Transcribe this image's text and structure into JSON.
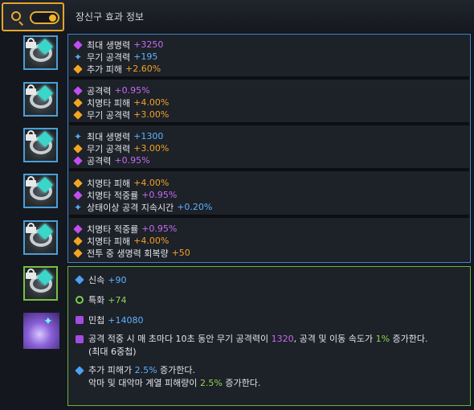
{
  "header": {
    "title": "장신구 효과 정보"
  },
  "panels": [
    {
      "rows": [
        {
          "icon": "purple",
          "label": "최대 생명력",
          "value": "+3250",
          "color": "purple"
        },
        {
          "icon": "star",
          "label": "무기 공격력",
          "value": "+195",
          "color": "blue"
        },
        {
          "icon": "orange",
          "label": "추가 피해",
          "value": "+2.60%",
          "color": "orange"
        }
      ]
    },
    {
      "rows": [
        {
          "icon": "purple",
          "label": "공격력",
          "value": "+0.95%",
          "color": "purple"
        },
        {
          "icon": "orange",
          "label": "치명타 피해",
          "value": "+4.00%",
          "color": "orange"
        },
        {
          "icon": "orange",
          "label": "무기 공격력",
          "value": "+3.00%",
          "color": "orange"
        }
      ]
    },
    {
      "rows": [
        {
          "icon": "star",
          "label": "최대 생명력",
          "value": "+1300",
          "color": "blue"
        },
        {
          "icon": "orange",
          "label": "무기 공격력",
          "value": "+3.00%",
          "color": "orange"
        },
        {
          "icon": "purple",
          "label": "공격력",
          "value": "+0.95%",
          "color": "purple"
        }
      ]
    },
    {
      "rows": [
        {
          "icon": "orange",
          "label": "치명타 피해",
          "value": "+4.00%",
          "color": "orange"
        },
        {
          "icon": "purple",
          "label": "치명타 적중률",
          "value": "+0.95%",
          "color": "purple"
        },
        {
          "icon": "star",
          "label": "상태이상 공격 지속시간",
          "value": "+0.20%",
          "color": "blue"
        }
      ]
    },
    {
      "rows": [
        {
          "icon": "purple",
          "label": "치명타 적중률",
          "value": "+0.95%",
          "color": "purple"
        },
        {
          "icon": "orange",
          "label": "치명타 피해",
          "value": "+4.00%",
          "color": "orange"
        },
        {
          "icon": "orange",
          "label": "전투 중 생명력 회복량",
          "value": "+50",
          "color": "orange"
        }
      ]
    }
  ],
  "bracelet": {
    "swiftness": {
      "label": "신속",
      "value": "+90"
    },
    "specialization": {
      "label": "특화",
      "value": "+74"
    },
    "dexterity": {
      "label": "민첩",
      "value": "+14080"
    },
    "effect1": {
      "pre": "공격 적중 시 매 초마다 10초 동안 무기 공격력이 ",
      "v1": "1320",
      "mid": ", 공격 및 이동 속도가 ",
      "v2": "1%",
      "post": " 증가한다.",
      "line2": "(최대 6중첩)"
    },
    "effect2": {
      "pre": "추가 피해가 ",
      "v1": "2.5%",
      "post": " 증가한다.",
      "line2pre": "악마 및 대악마 계열 피해량이 ",
      "v2": "2.5%",
      "line2post": " 증가한다."
    }
  },
  "icons": [
    "search-icon",
    "toggle-switch",
    "lock-icon",
    "ring-icon",
    "bracelet-icon"
  ],
  "colors": {
    "accent": "#e5a52c",
    "border_blue": "#3a86c8",
    "border_green": "#69b63f",
    "value_purple": "#c66cf2",
    "value_blue": "#5eb3ff",
    "value_orange": "#f1a227",
    "value_green": "#8fd554"
  }
}
